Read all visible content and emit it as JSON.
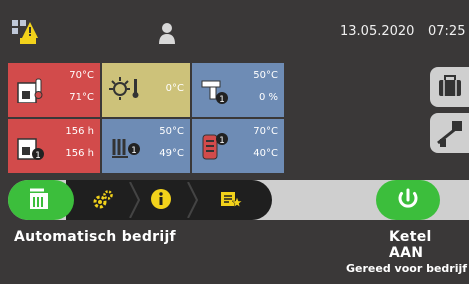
{
  "header": {
    "date": "13.05.2020",
    "time": "07:25"
  },
  "tiles": {
    "boiler_temp": {
      "actual": "70°C",
      "target": "71°C"
    },
    "outdoor": {
      "value": "0°C"
    },
    "dhw": {
      "temp": "50°C",
      "percent": "0 %"
    },
    "hours": {
      "first": "156 h",
      "second": "156 h"
    },
    "floor_heating": {
      "actual": "50°C",
      "target": "49°C"
    },
    "buffer": {
      "top": "70°C",
      "bottom": "40°C"
    }
  },
  "status": {
    "mode": "Automatisch bedrijf",
    "boiler": "Ketel AAN",
    "message": "Gereed voor bedrijf"
  },
  "colors": {
    "red_tile": "#d24b4b",
    "yellow_tile": "#cdc27a",
    "blue_tile": "#6e8cb5",
    "green_active": "#3cbe3c",
    "icon_yellow": "#f2d21b"
  },
  "icons": [
    "system-status-icon",
    "user-icon",
    "boiler-thermometer-icon",
    "outdoor-sun-icon",
    "tap-water-icon",
    "boiler-hours-icon",
    "floor-heating-icon",
    "buffer-tank-icon",
    "toolbox-icon",
    "chimney-sweep-icon",
    "automatic-mode-icon",
    "settings-gears-icon",
    "info-icon",
    "notes-star-icon",
    "power-icon"
  ]
}
